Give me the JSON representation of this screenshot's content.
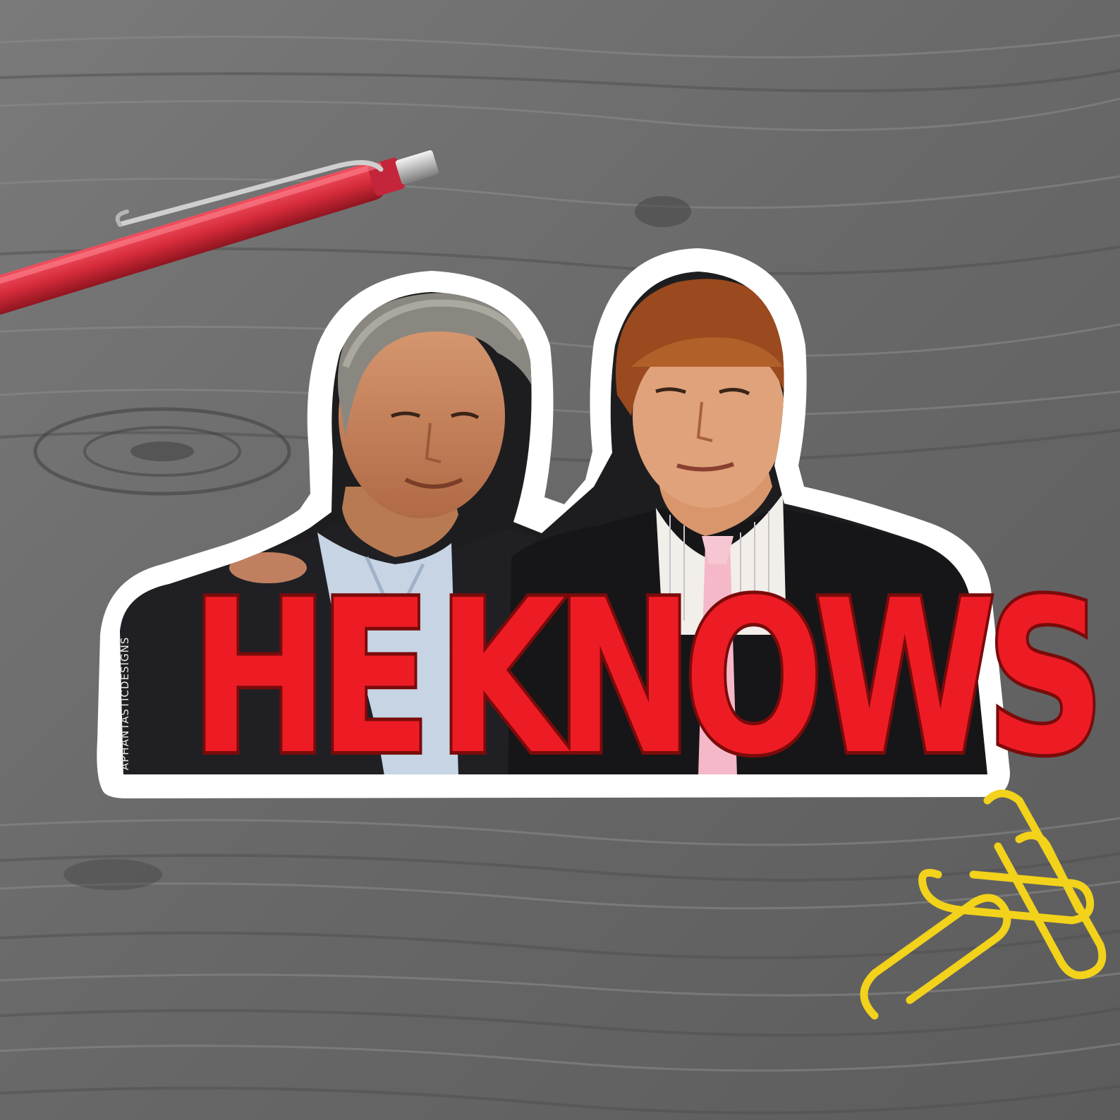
{
  "sticker": {
    "headline_word_1": "HE",
    "headline_word_2": "KNOWS",
    "watermark": "APHANTASTICDESIGNS"
  },
  "objects": {
    "pen": "red-pen-icon",
    "paperclips": "yellow-paperclips-icon"
  },
  "colors": {
    "background_wood": "#6f6f6f",
    "sticker_border": "#ffffff",
    "headline_fill": "#ed1c24",
    "headline_outline": "#7a0b0b",
    "pen_body": "#d62b3a",
    "paperclip": "#f2d21a"
  }
}
